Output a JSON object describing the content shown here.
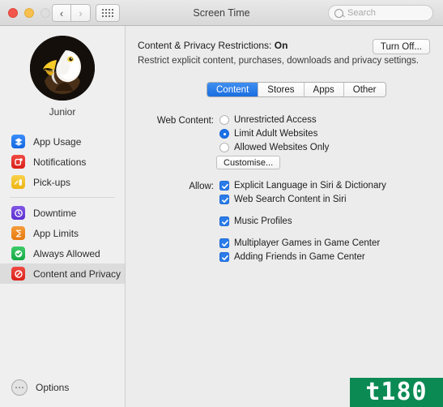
{
  "window": {
    "title": "Screen Time",
    "traffic_lights": [
      "close",
      "minimize",
      "zoom"
    ],
    "nav_back": "‹",
    "nav_forward": "›",
    "grid_icon": "grid-icon"
  },
  "search": {
    "placeholder": "Search",
    "icon": "search-icon"
  },
  "sidebar": {
    "user": {
      "name": "Junior",
      "avatar": "eagle-avatar"
    },
    "items": [
      {
        "label": "App Usage",
        "icon": "app-usage-icon",
        "color": "#1a73e8",
        "selected": false
      },
      {
        "label": "Notifications",
        "icon": "notifications-icon",
        "color": "#e8322c",
        "selected": false
      },
      {
        "label": "Pick-ups",
        "icon": "pickups-icon",
        "color": "#f2c025",
        "selected": false
      },
      {
        "label": "Downtime",
        "icon": "downtime-icon",
        "color": "#6b40d8",
        "selected": false
      },
      {
        "label": "App Limits",
        "icon": "app-limits-icon",
        "color": "#f08a24",
        "selected": false
      },
      {
        "label": "Always Allowed",
        "icon": "always-allowed-icon",
        "color": "#23b council",
        "selected": false
      },
      {
        "label": "Content and Privacy",
        "icon": "content-privacy-icon",
        "color": "#e8322c",
        "selected": true
      }
    ],
    "options": {
      "label": "Options",
      "icon": "options-ellipsis-icon"
    }
  },
  "main": {
    "header_prefix": "Content & Privacy Restrictions: ",
    "header_state": "On",
    "description": "Restrict explicit content, purchases, downloads and privacy settings.",
    "turn_off_label": "Turn Off...",
    "tabs": [
      {
        "label": "Content",
        "active": true
      },
      {
        "label": "Stores",
        "active": false
      },
      {
        "label": "Apps",
        "active": false
      },
      {
        "label": "Other",
        "active": false
      }
    ],
    "web_content": {
      "label": "Web Content:",
      "options": [
        {
          "label": "Unrestricted Access",
          "selected": false
        },
        {
          "label": "Limit Adult Websites",
          "selected": true
        },
        {
          "label": "Allowed Websites Only",
          "selected": false
        }
      ],
      "customise_label": "Customise..."
    },
    "allow": {
      "label": "Allow:",
      "items": [
        {
          "label": "Explicit Language in Siri & Dictionary",
          "checked": true
        },
        {
          "label": "Web Search Content in Siri",
          "checked": true
        },
        {
          "label": "Music Profiles",
          "checked": true
        },
        {
          "label": "Multiplayer Games in Game Center",
          "checked": true
        },
        {
          "label": "Adding Friends in Game Center",
          "checked": true
        }
      ]
    }
  },
  "watermark": {
    "text": "t180",
    "color": "#0b8a54"
  }
}
